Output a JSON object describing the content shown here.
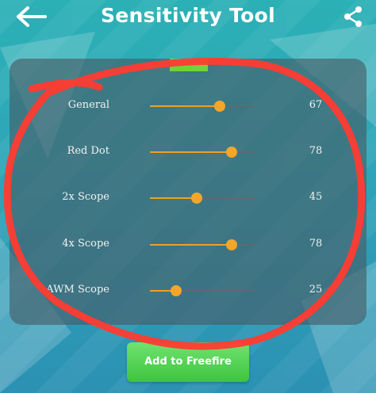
{
  "header": {
    "title": "Sensitivity Tool",
    "back_icon": "arrow-left-icon",
    "share_icon": "share-icon"
  },
  "sliders": [
    {
      "label": "General",
      "value": "67",
      "level": 0.67
    },
    {
      "label": "Red Dot",
      "value": "78",
      "level": 0.78
    },
    {
      "label": "2x Scope",
      "value": "45",
      "level": 0.45
    },
    {
      "label": "4x Scope",
      "value": "78",
      "level": 0.78
    },
    {
      "label": "AWM Scope",
      "value": "25",
      "level": 0.25
    }
  ],
  "action": {
    "add_label": "Add to Freefire"
  },
  "colors": {
    "accent": "#f0a020",
    "button": "#4fd14f",
    "annotation": "#ff3b30"
  }
}
